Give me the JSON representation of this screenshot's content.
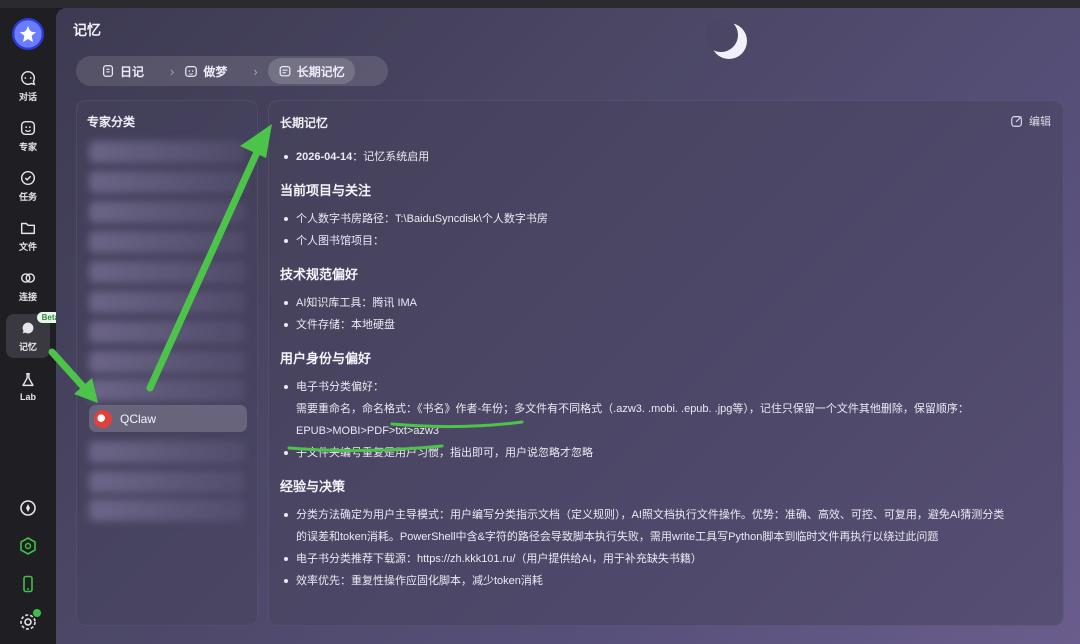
{
  "rail": {
    "items": [
      {
        "label": "对话",
        "icon": "chat-icon"
      },
      {
        "label": "专家",
        "icon": "expert-icon"
      },
      {
        "label": "任务",
        "icon": "task-icon"
      },
      {
        "label": "文件",
        "icon": "folder-icon"
      },
      {
        "label": "连接",
        "icon": "link-icon"
      },
      {
        "label": "记忆",
        "icon": "memory-icon",
        "badge": "Beta"
      },
      {
        "label": "Lab",
        "icon": "flask-icon"
      }
    ]
  },
  "page": {
    "title": "记忆"
  },
  "tabs": [
    {
      "label": "日记",
      "icon": "diary-icon"
    },
    {
      "label": "做梦",
      "icon": "dream-icon"
    },
    {
      "label": "长期记忆",
      "icon": "calendar-icon"
    }
  ],
  "expert_panel": {
    "title": "专家分类",
    "selected": "QClaw"
  },
  "memory": {
    "title": "长期记忆",
    "edit_label": "编辑",
    "intro_date": "2026-04-14",
    "intro_text": "：记忆系统启用",
    "sections": [
      {
        "heading": "当前项目与关注",
        "items": [
          "个人数字书房路径：T:\\BaiduSyncdisk\\个人数字书房",
          "个人图书馆项目："
        ]
      },
      {
        "heading": "技术规范偏好",
        "items": [
          "AI知识库工具：腾讯 IMA",
          "文件存储：本地硬盘"
        ]
      },
      {
        "heading": "用户身份与偏好",
        "items": [
          "电子书分类偏好：",
          "需要重命名，命名格式：《书名》作者-年份；多文件有不同格式（.azw3. .mobi. .epub. .jpg等），记住只保留一个文件其他删除，保留顺序：",
          "EPUB>MOBI>PDF>txt>azw3",
          "子文件夹编号重复是用户习惯，指出即可，用户说忽略才忽略"
        ]
      },
      {
        "heading": "经验与决策",
        "items": [
          "分类方法确定为用户主导模式：用户编写分类指示文档（定义规则），AI照文档执行文件操作。优势：准确、高效、可控、可复用，避免AI猜测分类",
          "的误差和token消耗。PowerShell中含&字符的路径会导致脚本执行失败，需用write工具写Python脚本到临时文件再执行以绕过此问题",
          "电子书分类推荐下载源：https://zh.kkk101.ru/（用户提供给AI，用于补充缺失书籍）",
          "效率优先：重复性操作应固化脚本，减少token消耗"
        ]
      }
    ]
  },
  "colors": {
    "accent_green": "#3fbf4a",
    "annotation_arrow": "#4cc44a"
  }
}
